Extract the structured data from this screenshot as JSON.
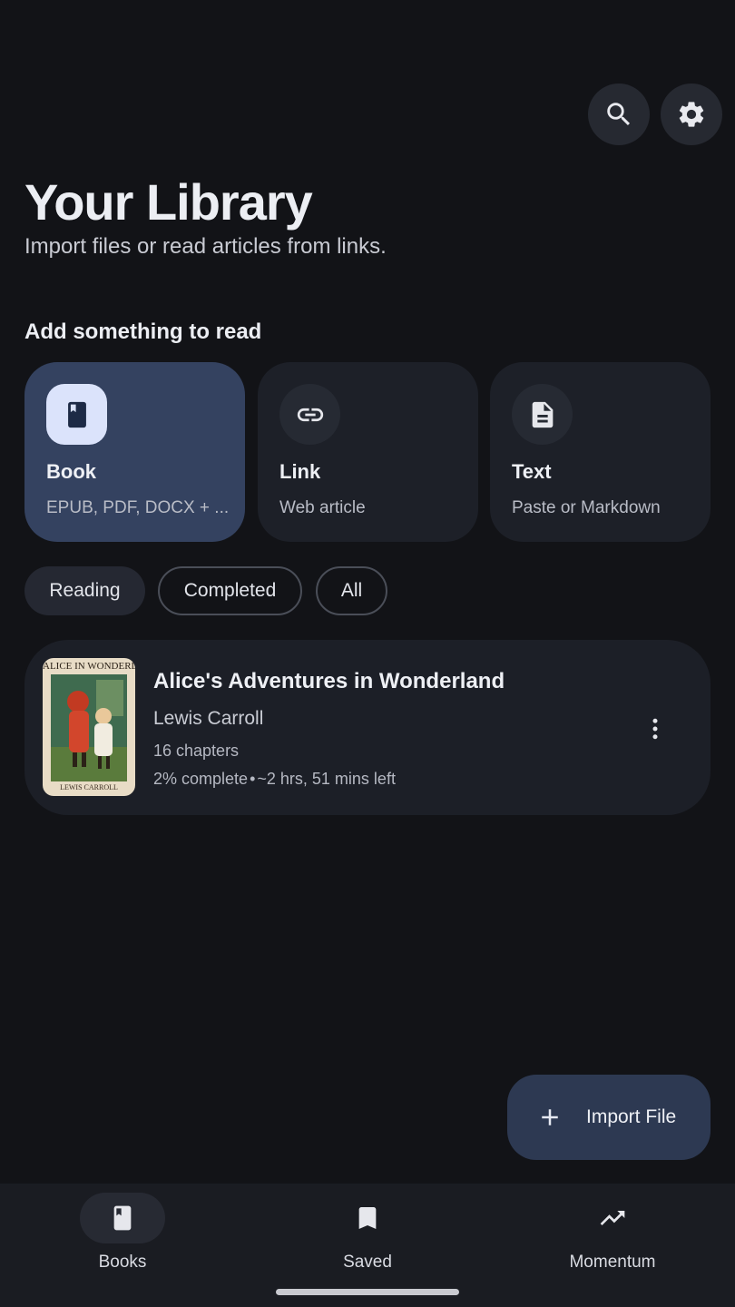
{
  "header": {
    "search_icon": "search-icon",
    "settings_icon": "gear-icon",
    "title": "Your Library",
    "subtitle": "Import files or read articles from links."
  },
  "add_section": {
    "title": "Add something to read",
    "cards": [
      {
        "label": "Book",
        "sublabel": "EPUB, PDF, DOCX + ...",
        "icon": "book-icon",
        "selected": true
      },
      {
        "label": "Link",
        "sublabel": "Web article",
        "icon": "link-icon",
        "selected": false
      },
      {
        "label": "Text",
        "sublabel": "Paste or Markdown",
        "icon": "document-icon",
        "selected": false
      }
    ]
  },
  "filters": {
    "chips": [
      "Reading",
      "Completed",
      "All"
    ],
    "selected": "Reading"
  },
  "books": [
    {
      "cover_title": "ALICE IN WONDERLAND",
      "cover_author": "LEWIS CARROLL",
      "title": "Alice's Adventures in Wonderland",
      "author": "Lewis Carroll",
      "chapters": "16 chapters",
      "progress": "2% complete",
      "separator": "•",
      "time_left": "~2 hrs, 51 mins left"
    }
  ],
  "fab": {
    "label": "Import File",
    "icon": "plus-icon"
  },
  "bottom_nav": {
    "items": [
      {
        "label": "Books",
        "icon": "book-icon",
        "active": true
      },
      {
        "label": "Saved",
        "icon": "bookmark-icon",
        "active": false
      },
      {
        "label": "Momentum",
        "icon": "trending-up-icon",
        "active": false
      }
    ]
  },
  "colors": {
    "background": "#121317",
    "card": "#1d2028",
    "card_active": "#344260",
    "fab": "#2d3952",
    "nav": "#1a1c22"
  }
}
